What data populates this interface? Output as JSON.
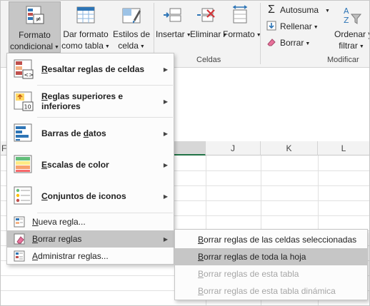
{
  "ribbon": {
    "buttons": {
      "conditional_format": {
        "line1": "Formato",
        "line2": "condicional"
      },
      "format_table": {
        "line1": "Dar formato",
        "line2": "como tabla"
      },
      "cell_styles": {
        "line1": "Estilos de",
        "line2": "celda"
      },
      "insert": {
        "label": "Insertar"
      },
      "delete": {
        "label": "Eliminar"
      },
      "format": {
        "label": "Formato"
      }
    },
    "groups": {
      "cells": "Celdas",
      "modify": "Modificar"
    },
    "modify": {
      "autosum": "Autosuma",
      "fill": "Rellenar",
      "clear": "Borrar",
      "sort_filter_line1": "Ordenar y",
      "sort_filter_line2": "filtrar"
    }
  },
  "grid": {
    "columns": [
      "F",
      "J",
      "K",
      "L"
    ]
  },
  "menu": {
    "items": [
      {
        "pre": "",
        "acc": "R",
        "post": "esaltar reglas de celdas"
      },
      {
        "pre": "",
        "acc": "R",
        "post": "eglas superiores e inferiores"
      },
      {
        "pre": "Barras de ",
        "acc": "d",
        "post": "atos"
      },
      {
        "pre": "",
        "acc": "E",
        "post": "scalas de color"
      },
      {
        "pre": "",
        "acc": "C",
        "post": "onjuntos de iconos"
      },
      {
        "pre": "",
        "acc": "N",
        "post": "ueva regla..."
      },
      {
        "pre": "",
        "acc": "B",
        "post": "orrar reglas"
      },
      {
        "pre": "",
        "acc": "A",
        "post": "dministrar reglas..."
      }
    ]
  },
  "submenu": {
    "items": [
      {
        "acc": "B",
        "post": "orrar reglas de las celdas seleccionadas"
      },
      {
        "acc": "B",
        "post": "orrar reglas de toda la hoja"
      },
      {
        "acc": "B",
        "post": "orrar reglas de esta tabla"
      },
      {
        "acc": "B",
        "post": "orrar reglas de esta tabla dinámica"
      }
    ]
  },
  "colors": {
    "excel_green": "#217346",
    "highlight": "#c6c6c6",
    "disabled_text": "#a6a6a6"
  }
}
